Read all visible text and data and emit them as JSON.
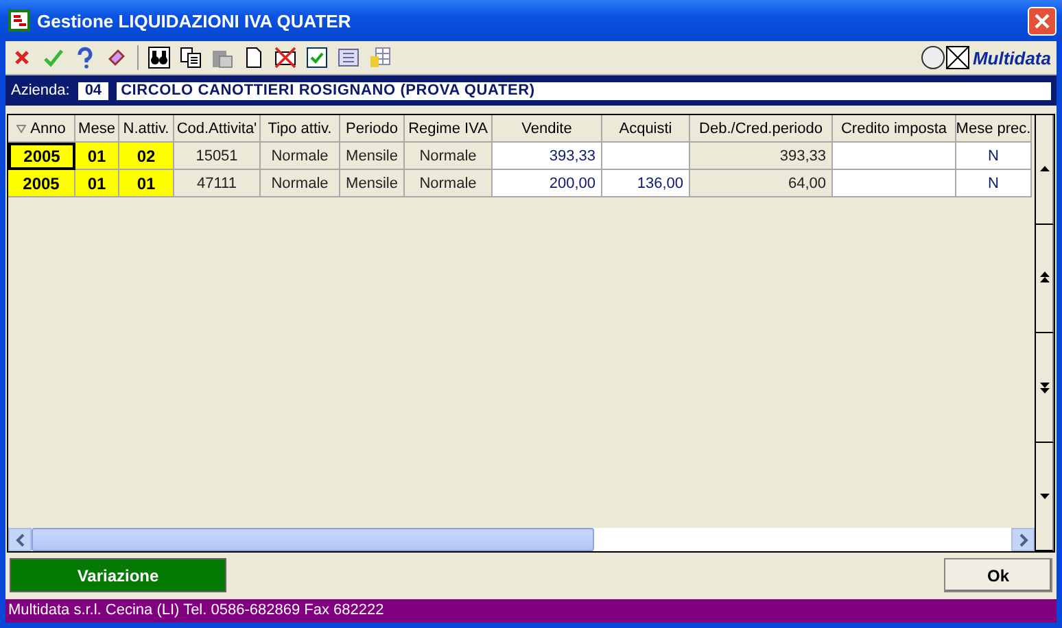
{
  "window": {
    "title": "Gestione LIQUIDAZIONI IVA QUATER"
  },
  "brand": "Multidata",
  "azienda": {
    "label": "Azienda:",
    "code": "04",
    "name": "CIRCOLO CANOTTIERI ROSIGNANO (PROVA QUATER)"
  },
  "table": {
    "columns": [
      {
        "label": "Anno",
        "kind": "key",
        "sorted": true
      },
      {
        "label": "Mese",
        "kind": "key",
        "sorted": false
      },
      {
        "label": "N.attiv.",
        "kind": "key",
        "sorted": false
      },
      {
        "label": "Cod.Attivita'",
        "kind": "label",
        "sorted": false
      },
      {
        "label": "Tipo attiv.",
        "kind": "label",
        "sorted": false
      },
      {
        "label": "Periodo",
        "kind": "label",
        "sorted": false
      },
      {
        "label": "Regime IVA",
        "kind": "label",
        "sorted": false
      },
      {
        "label": "Vendite",
        "kind": "amount",
        "sorted": false
      },
      {
        "label": "Acquisti",
        "kind": "amount",
        "sorted": false
      },
      {
        "label": "Deb./Cred.periodo",
        "kind": "total",
        "sorted": false
      },
      {
        "label": "Credito imposta",
        "kind": "amount",
        "sorted": false
      },
      {
        "label": "Mese prec.",
        "kind": "flag",
        "sorted": false
      }
    ],
    "rows": [
      {
        "focused": true,
        "cells": [
          "2005",
          "01",
          "02",
          "15051",
          "Normale",
          "Mensile",
          "Normale",
          "393,33",
          "",
          "393,33",
          "",
          "N"
        ]
      },
      {
        "focused": false,
        "cells": [
          "2005",
          "01",
          "01",
          "47111",
          "Normale",
          "Mensile",
          "Normale",
          "200,00",
          "136,00",
          "64,00",
          "",
          "N"
        ]
      }
    ]
  },
  "buttons": [
    {
      "label": "Variazione",
      "kind": "primary"
    },
    {
      "label": "Ok",
      "kind": "plain"
    }
  ],
  "status_bar": "Multidata s.r.l. Cecina (LI) Tel. 0586-682869  Fax 682222"
}
